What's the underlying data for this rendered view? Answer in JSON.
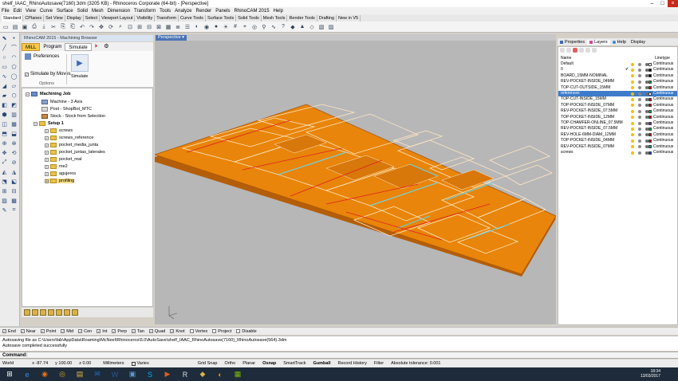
{
  "window": {
    "title": "shelf_IAAC_RhinoAutosave(7160).3dm (3205 KB) - Rhinoceros Corporate (64-bit) - [Perspective]"
  },
  "menu": [
    "File",
    "Edit",
    "View",
    "Curve",
    "Surface",
    "Solid",
    "Mesh",
    "Dimension",
    "Transform",
    "Tools",
    "Analyze",
    "Render",
    "Panels",
    "RhinoCAM 2015",
    "Help"
  ],
  "toolbar_tabs": [
    "Standard",
    "CPlanes",
    "Set View",
    "Display",
    "Select",
    "Viewport Layout",
    "Visibility",
    "Transform",
    "Curve Tools",
    "Surface Tools",
    "Solid Tools",
    "Mesh Tools",
    "Render Tools",
    "Drafting",
    "New in V5"
  ],
  "toolbar_icons": [
    "new-icon",
    "open-icon",
    "save-icon",
    "print-icon",
    "import-icon",
    "cut-icon",
    "copy-icon",
    "paste-icon",
    "undo-icon",
    "redo-icon",
    "pan-icon",
    "rotate-view-icon",
    "zoom-icon",
    "zoom-window-icon",
    "zoom-extents-icon",
    "zoom-selected-icon",
    "zoom-all-icon",
    "viewport-icon",
    "layer-icon",
    "properties-icon",
    "shade-icon",
    "render-icon",
    "material-icon",
    "light-icon",
    "grid-icon",
    "snap-icon",
    "osnap-icon",
    "analyze-icon",
    "curvature-icon",
    "help-icon",
    "rhinocam-icon",
    "mill-icon",
    "lathe-icon",
    "nest-icon",
    "nest2-icon"
  ],
  "rhinocam": {
    "header": "RhinoCAM 2015 - Machining Browser",
    "tabs": [
      "MILL",
      "Program",
      "Simulate"
    ],
    "ribbon": {
      "preferences": "Preferences",
      "simulate_by_moves": "Simulate by Moves",
      "group_options": "Options",
      "group_simulate": "Simulate"
    },
    "tree": {
      "root": "Machining Job",
      "machine": "Machine - 3 Axis",
      "post": "Post - ShopBot_MTC",
      "stock": "Stock - Stock from Selection",
      "setup": "Setup 1",
      "items": [
        "screws",
        "screws_reference",
        "pocket_media_junta",
        "pocket_juntas_laterales",
        "pocket_real",
        "me2",
        "agujeros",
        "profiling"
      ],
      "selected": "profiling"
    }
  },
  "viewport": {
    "label": "Perspective"
  },
  "right_panel": {
    "tabs": [
      "Properties",
      "Layers",
      "Help",
      "Display"
    ],
    "active_tab": "Layers",
    "col_name": "Name",
    "col_linetype": "Linetype",
    "layers": [
      {
        "name": "Default",
        "color": "#ffffff",
        "linetype": "Continuous"
      },
      {
        "name": "0",
        "color": "#000000",
        "linetype": "Continuous"
      },
      {
        "name": "BOARD_15MM-NOMINAL",
        "color": "#000000",
        "linetype": "Continuous"
      },
      {
        "name": "REV-POCKET-INSIDE_04MM",
        "color": "#00aa44",
        "linetype": "Continuous"
      },
      {
        "name": "TOP-CUT-OUTSIDE_15MM",
        "color": "#cc0000",
        "linetype": "Continuous"
      },
      {
        "name": "references",
        "color": "#ffffff",
        "linetype": "Continuous"
      },
      {
        "name": "TOP-CUT-INSIDE_15MM",
        "color": "#cc0000",
        "linetype": "Continuous"
      },
      {
        "name": "TOP-POCKET-INSIDE_07MM",
        "color": "#cc0000",
        "linetype": "Continuous"
      },
      {
        "name": "REV-POCKET-INSIDE_07.5MM",
        "color": "#00aa44",
        "linetype": "Continuous"
      },
      {
        "name": "TOP-POCKET-INSIDE_12MM",
        "color": "#cc0000",
        "linetype": "Continuous"
      },
      {
        "name": "TOP-CHAMFER-ONLINE_07.5MM",
        "color": "#6a2fa0",
        "linetype": "Continuous"
      },
      {
        "name": "REV-POCKET-INSIDE_07.5MM",
        "color": "#00aa44",
        "linetype": "Continuous"
      },
      {
        "name": "REV-HOLE-6MM-DIAM_12MM",
        "color": "#cc0000",
        "linetype": "Continuous"
      },
      {
        "name": "TOP-POCKET-INSIDE_04MM",
        "color": "#cc0000",
        "linetype": "Continuous"
      },
      {
        "name": "REV-POCKET-INSIDE_07MM",
        "color": "#00aa44",
        "linetype": "Continuous"
      },
      {
        "name": "screws",
        "color": "#1d3fbf",
        "linetype": "Continuous"
      }
    ],
    "selected_layer": "references",
    "current_marker": "✔"
  },
  "osnap": [
    {
      "label": "End",
      "checked": true
    },
    {
      "label": "Near",
      "checked": true
    },
    {
      "label": "Point",
      "checked": true
    },
    {
      "label": "Mid",
      "checked": true
    },
    {
      "label": "Cen",
      "checked": true
    },
    {
      "label": "Int",
      "checked": true
    },
    {
      "label": "Perp",
      "checked": true
    },
    {
      "label": "Tan",
      "checked": true
    },
    {
      "label": "Quad",
      "checked": true
    },
    {
      "label": "Knot",
      "checked": true
    },
    {
      "label": "Vertex",
      "checked": false
    },
    {
      "label": "Project",
      "checked": false
    },
    {
      "label": "Disable",
      "checked": false
    }
  ],
  "command_history": [
    "Autosaving file as C:\\Users\\fab\\AppData\\Roaming\\McNeel\\Rhinoceros\\5.0\\AutoSave\\shelf_IAAC_RhinoAutosave(7160)_RhinoAutosave(564).3dm",
    "Autosave completed successfully"
  ],
  "command_prompt": "Command:",
  "status": {
    "cplane": "World",
    "x": "x -87.74",
    "y": "y 100.00",
    "z": "z 0.00",
    "units": "Millimeters",
    "layer": "Varies",
    "grid_snap": "Grid Snap",
    "ortho": "Ortho",
    "planar": "Planar",
    "osnap": "Osnap",
    "smarttrack": "SmartTrack",
    "gumball": "Gumball",
    "record_history": "Record History",
    "filter": "Filter",
    "tolerance": "Absolute tolerance: 0.001"
  },
  "taskbar": {
    "time": "18:34",
    "date": "13/03/2017",
    "apps": [
      "start-icon",
      "ie-icon",
      "firefox-icon",
      "chrome-icon",
      "folder-icon",
      "outlook-icon",
      "word-icon",
      "photo-icon",
      "skype-icon",
      "media-icon",
      "rhino-icon",
      "rhinocam-icon",
      "blender-icon",
      "app-icon"
    ]
  },
  "colors": {
    "accent": "#3d7cc9",
    "board": "#e8850a"
  }
}
